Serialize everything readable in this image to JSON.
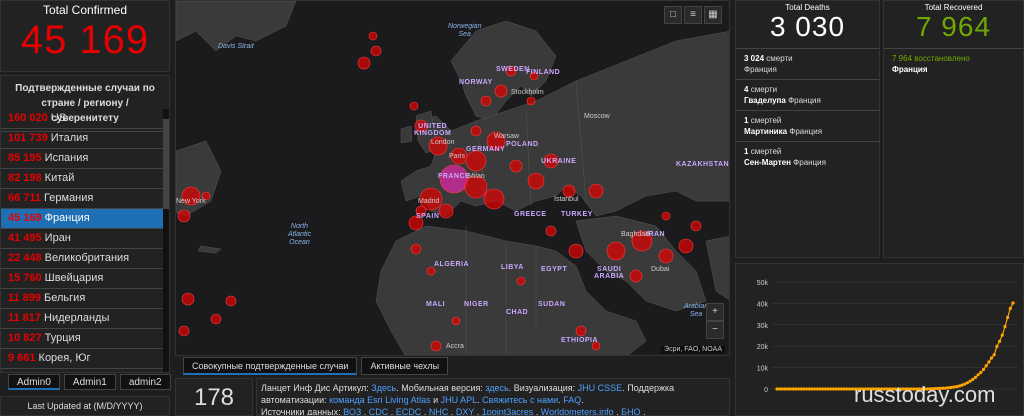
{
  "total_confirmed": {
    "label": "Total Confirmed",
    "value": "45 169"
  },
  "country_list": {
    "header": "Подтвержденные случаи по стране / региону / суверенитету",
    "rows": [
      {
        "num": "160 020",
        "name": "US"
      },
      {
        "num": "101 739",
        "name": "Италия"
      },
      {
        "num": "85 195",
        "name": "Испания"
      },
      {
        "num": "82 198",
        "name": "Китай"
      },
      {
        "num": "66 711",
        "name": "Германия"
      },
      {
        "num": "45 169",
        "name": "Франция"
      },
      {
        "num": "41 495",
        "name": "Иран"
      },
      {
        "num": "22 448",
        "name": "Великобритания"
      },
      {
        "num": "15 760",
        "name": "Швейцария"
      },
      {
        "num": "11 899",
        "name": "Бельгия"
      },
      {
        "num": "11 817",
        "name": "Нидерланды"
      },
      {
        "num": "10 827",
        "name": "Турция"
      },
      {
        "num": "9 661",
        "name": "Корея, Юг"
      }
    ],
    "selected_index": 5
  },
  "admin_tabs": [
    "Admin0",
    "Admin1",
    "admin2"
  ],
  "last_updated_label": "Last Updated at (M/D/YYYY)",
  "map": {
    "seas": [
      {
        "text": "Davis\nStrait"
      },
      {
        "text": "Norwegian\nSea"
      },
      {
        "text": "North\nAtlantic\nOcean"
      },
      {
        "text": "Arabian\nSea"
      }
    ],
    "countries": [
      "SWEDEN",
      "FINLAND",
      "NORWAY",
      "UNITED\nKINGDOM",
      "GERMANY",
      "POLAND",
      "UKRAINE",
      "KAZAKHSTAN",
      "FRANCE",
      "SPAIN",
      "GREECE",
      "TURKEY",
      "ALGERIA",
      "LIBYA",
      "EGYPT",
      "SAUDI\nARABIA",
      "MALI",
      "NIGER",
      "CHAD",
      "SUDAN",
      "ETHIOPIA",
      "IRAN"
    ],
    "cities": [
      "Stockholm",
      "Moscow",
      "London",
      "Paris",
      "Warsaw",
      "Milan",
      "Madrid",
      "New York",
      "Istanbul",
      "Baghdad",
      "Dubai",
      "Accra"
    ],
    "attribution": "Эсри, FAO, NOAA",
    "zoom_in": "+",
    "zoom_out": "−"
  },
  "map_tabs": [
    "Совокупные подтвержденные случаи",
    "Активные чехлы"
  ],
  "countries_count": "178",
  "info": {
    "l1a": "Ланцет Инф Дис Артикул: ",
    "l1b": "Здесь",
    "l1c": ". Мобильная версия: ",
    "l1d": "здесь",
    "l1e": ". Визуализация: ",
    "l1f": "JHU CSSE",
    "l1g": ". Поддержка",
    "l2a": "автоматизации: ",
    "l2b": "команда Esri Living Atlas",
    "l2c": " и ",
    "l2d": "JHU APL",
    "l2e": ". ",
    "l2f": "Свяжитесь с нами",
    "l2g": ". ",
    "l2h": "FAQ",
    "l2i": ".",
    "l3a": "Источники данных: ",
    "l3b": "ВОЗ",
    "l3c": " , ",
    "l3d": "CDC",
    "l3e": " , ",
    "l3f": "ECDC",
    "l3g": " , ",
    "l3h": "NHC",
    "l3i": " , ",
    "l3j": "DXY",
    "l3k": " , ",
    "l3l": "1point3acres",
    "l3m": " , ",
    "l3n": "Worldometers.info",
    "l3o": " , ",
    "l3p": "БНО",
    "l3q": " ,"
  },
  "deaths": {
    "label": "Total Deaths",
    "value": "3 030",
    "items": [
      {
        "num": "3 024",
        "unit": "смерти",
        "place": "Франция",
        "bold_place": ""
      },
      {
        "num": "4",
        "unit": "смерти",
        "place": "Франция",
        "bold_place": "Гваделупа"
      },
      {
        "num": "1",
        "unit": "смертей",
        "place": "Франция",
        "bold_place": "Мартиника"
      },
      {
        "num": "1",
        "unit": "смертей",
        "place": "Франция",
        "bold_place": "Сен-Мартен"
      }
    ]
  },
  "recovered": {
    "label": "Total Recovered",
    "value": "7 964",
    "item_num": "7 964",
    "item_text": "восстановлено",
    "item_place": "Франция"
  },
  "chart_data": {
    "type": "line",
    "y_ticks": [
      "0",
      "10k",
      "20k",
      "30k",
      "40k",
      "50k"
    ],
    "ylim": [
      0,
      50000
    ],
    "color": "#ffa500",
    "values": [
      0,
      0,
      0,
      0,
      0,
      0,
      0,
      0,
      0,
      0,
      0,
      0,
      0,
      0,
      0,
      0,
      0,
      0,
      0,
      0,
      0,
      0,
      0,
      0,
      0,
      0,
      0,
      0,
      0,
      0,
      0,
      0,
      0,
      0,
      0,
      0,
      0,
      0,
      0,
      0,
      0,
      0,
      0,
      0,
      0,
      0,
      0,
      0,
      0,
      0,
      0,
      0,
      0,
      0,
      0,
      0,
      0,
      100,
      130,
      190,
      240,
      290,
      380,
      440,
      610,
      710,
      950,
      1130,
      1410,
      1800,
      2300,
      2880,
      3660,
      4500,
      5420,
      6650,
      7700,
      9100,
      10900,
      12600,
      14500,
      16000,
      19900,
      22300,
      25200,
      29200,
      33400,
      37600,
      40200
    ]
  },
  "watermark": "russtoday.com"
}
